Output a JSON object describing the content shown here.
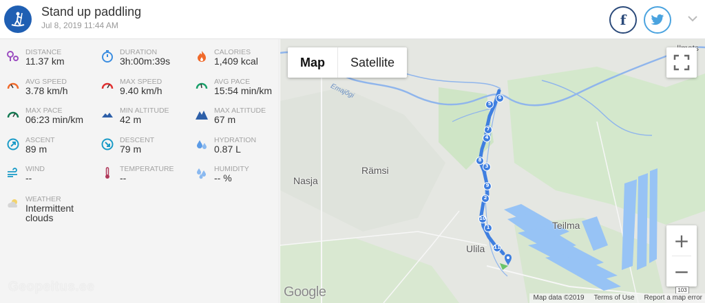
{
  "header": {
    "title": "Stand up paddling",
    "date": "Jul 8, 2019 11:44 AM",
    "facebook_label": "f",
    "accent": "#1f5fb3"
  },
  "stats": [
    {
      "label": "DISTANCE",
      "value": "11.37 km",
      "icon": "route-icon"
    },
    {
      "label": "DURATION",
      "value": "3h:00m:39s",
      "icon": "stopwatch-icon"
    },
    {
      "label": "CALORIES",
      "value": "1,409 kcal",
      "icon": "flame-icon"
    },
    {
      "label": "AVG SPEED",
      "value": "3.78 km/h",
      "icon": "speedometer-icon"
    },
    {
      "label": "MAX SPEED",
      "value": "9.40 km/h",
      "icon": "speedometer-icon"
    },
    {
      "label": "AVG PACE",
      "value": "15:54 min/km",
      "icon": "pace-gauge-icon"
    },
    {
      "label": "MAX PACE",
      "value": "06:23 min/km",
      "icon": "pace-gauge-icon"
    },
    {
      "label": "MIN ALTITUDE",
      "value": "42 m",
      "icon": "mountain-icon"
    },
    {
      "label": "MAX ALTITUDE",
      "value": "67 m",
      "icon": "mountain-icon"
    },
    {
      "label": "ASCENT",
      "value": "89 m",
      "icon": "ascent-icon"
    },
    {
      "label": "DESCENT",
      "value": "79 m",
      "icon": "descent-icon"
    },
    {
      "label": "HYDRATION",
      "value": "0.87 L",
      "icon": "water-drops-icon"
    },
    {
      "label": "WIND",
      "value": "--",
      "icon": "wind-icon"
    },
    {
      "label": "TEMPERATURE",
      "value": "--",
      "icon": "thermometer-icon"
    },
    {
      "label": "HUMIDITY",
      "value": "-- %",
      "icon": "humidity-icon"
    },
    {
      "label": "WEATHER",
      "value": "Intermittent clouds",
      "icon": "cloud-sun-icon"
    }
  ],
  "watermark": "Geopeitus.ee",
  "map": {
    "type_map": "Map",
    "type_satellite": "Satellite",
    "zoom_in": "+",
    "zoom_out": "−",
    "places": {
      "nasja": "Nasja",
      "ramsi": "Rämsi",
      "teilma": "Teilma",
      "ulila": "Ulila",
      "ilmats": "Ilmats"
    },
    "river": "Emajõgi",
    "road_number": "103",
    "google_logo": "Google",
    "attribution": "Map data ©2019",
    "terms": "Terms of Use",
    "report": "Report a map error",
    "checkpoints": [
      "6",
      "5",
      "7",
      "4",
      "8",
      "3",
      "9",
      "2",
      "10",
      "1",
      "11"
    ],
    "route_color": "#3f7fe0"
  }
}
